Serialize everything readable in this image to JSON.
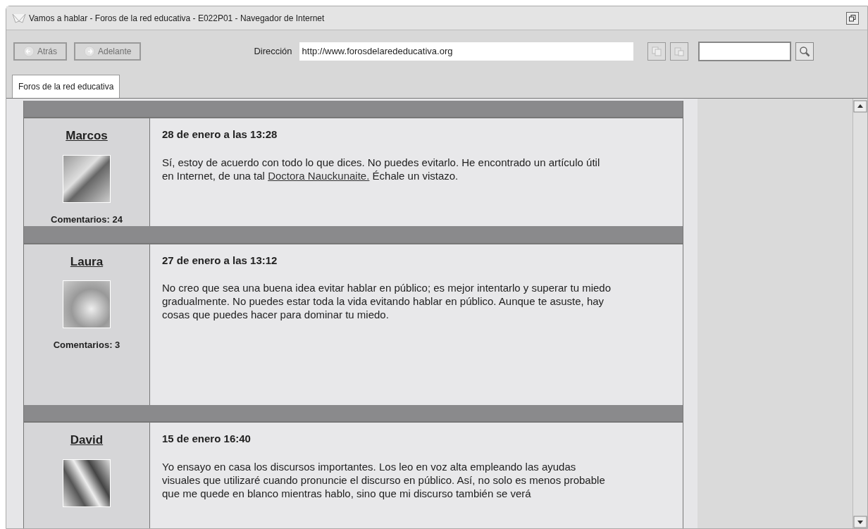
{
  "window": {
    "title": "Vamos a hablar - Foros de la red educativa - E022P01 - Navegador de Internet"
  },
  "toolbar": {
    "back": {
      "label": "Atrás",
      "disabled": true
    },
    "forward": {
      "label": "Adelante",
      "disabled": true
    },
    "address_label": "Dirección",
    "address": "http://www.forosdelarededucativa.org"
  },
  "tabs": [
    {
      "label": "Foros de la red educativa",
      "selected": true
    }
  ],
  "posts": [
    {
      "author": "Marcos",
      "comments": "Comentarios: 24",
      "date": "28 de enero a las 13:28",
      "message": [
        {
          "kind": "text",
          "text": "Sí, estoy de acuerdo con todo lo que dices. No puedes evitarlo. He encontrado un artículo útil en Internet, de una tal "
        },
        {
          "kind": "link",
          "text": "Doctora Nauckunaite."
        },
        {
          "kind": "text",
          "text": " Échale un vistazo."
        }
      ]
    },
    {
      "author": "Laura",
      "comments": "Comentarios: 3",
      "date": "27 de enero a las 13:12",
      "message": [
        {
          "kind": "text",
          "text": "No creo que sea una buena idea evitar hablar en público; es mejor intentarlo y superar tu miedo gradualmente. No puedes estar toda la vida evitando hablar en público. Aunque te asuste, hay cosas que puedes hacer para dominar tu miedo."
        }
      ]
    },
    {
      "author": "David",
      "date": "15 de enero 16:40",
      "message": [
        {
          "kind": "text",
          "text": "Yo ensayo en casa los discursos importantes. Los leo en voz alta empleando las ayudas visuales que utilizaré cuando pronuncie el discurso en público. Así, no solo es menos probable que me quede en blanco mientras hablo, sino que mi discurso también se verá"
        }
      ]
    }
  ]
}
